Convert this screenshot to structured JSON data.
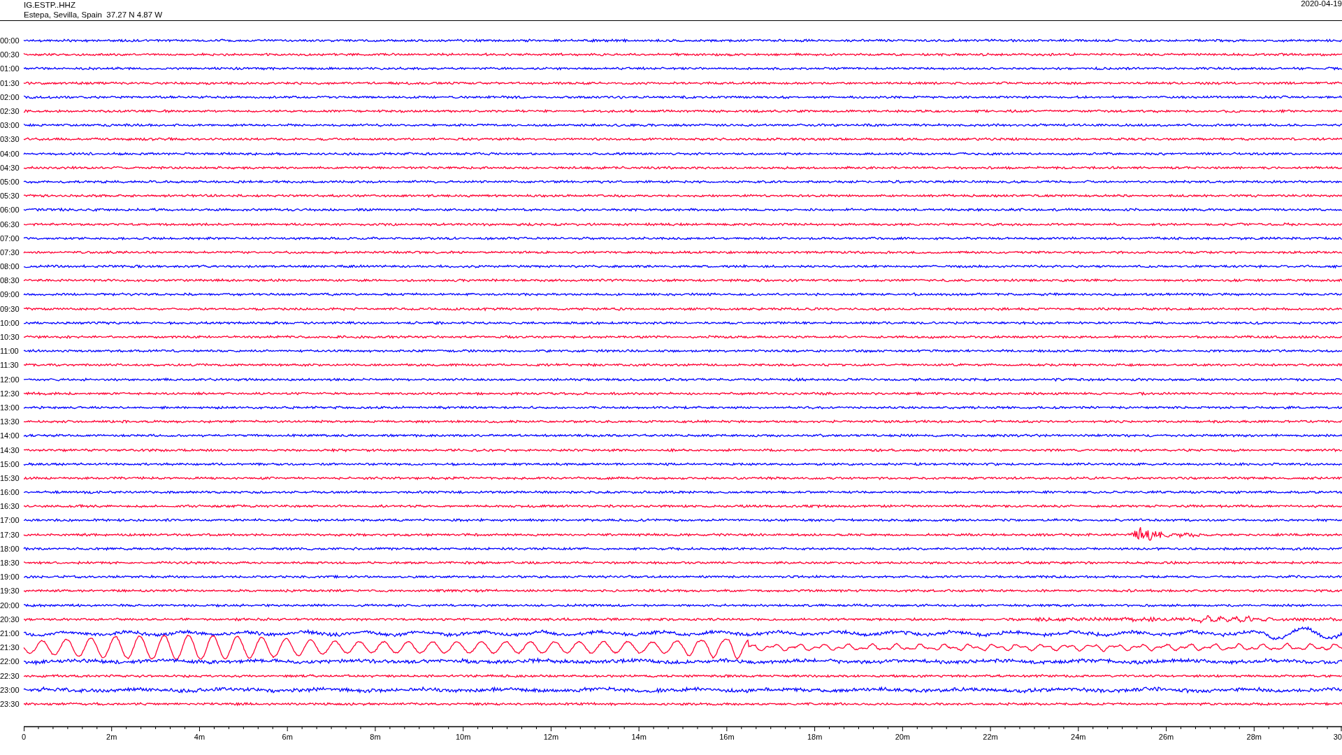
{
  "header": {
    "station": "IG.ESTP..HHZ",
    "location": "Estepa, Sevilla, Spain  37.27 N 4.87 W",
    "date": "2020-04-19"
  },
  "rows": [
    {
      "time": "00:00",
      "color": "#0000ff",
      "kind": "quiet"
    },
    {
      "time": "00:30",
      "color": "#ff0033",
      "kind": "quiet"
    },
    {
      "time": "01:00",
      "color": "#0000ff",
      "kind": "quiet"
    },
    {
      "time": "01:30",
      "color": "#ff0033",
      "kind": "quiet"
    },
    {
      "time": "02:00",
      "color": "#0000ff",
      "kind": "quiet"
    },
    {
      "time": "02:30",
      "color": "#ff0033",
      "kind": "quiet"
    },
    {
      "time": "03:00",
      "color": "#0000ff",
      "kind": "quiet"
    },
    {
      "time": "03:30",
      "color": "#ff0033",
      "kind": "quiet"
    },
    {
      "time": "04:00",
      "color": "#0000ff",
      "kind": "quiet"
    },
    {
      "time": "04:30",
      "color": "#ff0033",
      "kind": "quiet"
    },
    {
      "time": "05:00",
      "color": "#0000ff",
      "kind": "quiet"
    },
    {
      "time": "05:30",
      "color": "#ff0033",
      "kind": "quiet"
    },
    {
      "time": "06:00",
      "color": "#0000ff",
      "kind": "quiet"
    },
    {
      "time": "06:30",
      "color": "#ff0033",
      "kind": "quiet"
    },
    {
      "time": "07:00",
      "color": "#0000ff",
      "kind": "quiet"
    },
    {
      "time": "07:30",
      "color": "#ff0033",
      "kind": "quiet"
    },
    {
      "time": "08:00",
      "color": "#0000ff",
      "kind": "quiet"
    },
    {
      "time": "08:30",
      "color": "#ff0033",
      "kind": "quiet"
    },
    {
      "time": "09:00",
      "color": "#0000ff",
      "kind": "quiet"
    },
    {
      "time": "09:30",
      "color": "#ff0033",
      "kind": "quiet"
    },
    {
      "time": "10:00",
      "color": "#0000ff",
      "kind": "quiet"
    },
    {
      "time": "10:30",
      "color": "#ff0033",
      "kind": "quiet"
    },
    {
      "time": "11:00",
      "color": "#0000ff",
      "kind": "quiet"
    },
    {
      "time": "11:30",
      "color": "#ff0033",
      "kind": "quiet"
    },
    {
      "time": "12:00",
      "color": "#0000ff",
      "kind": "quiet"
    },
    {
      "time": "12:30",
      "color": "#ff0033",
      "kind": "quiet"
    },
    {
      "time": "13:00",
      "color": "#0000ff",
      "kind": "quiet"
    },
    {
      "time": "13:30",
      "color": "#ff0033",
      "kind": "quiet"
    },
    {
      "time": "14:00",
      "color": "#0000ff",
      "kind": "quiet"
    },
    {
      "time": "14:30",
      "color": "#ff0033",
      "kind": "quiet"
    },
    {
      "time": "15:00",
      "color": "#0000ff",
      "kind": "quiet"
    },
    {
      "time": "15:30",
      "color": "#ff0033",
      "kind": "quiet"
    },
    {
      "time": "16:00",
      "color": "#0000ff",
      "kind": "quiet"
    },
    {
      "time": "16:30",
      "color": "#ff0033",
      "kind": "quiet"
    },
    {
      "time": "17:00",
      "color": "#0000ff",
      "kind": "quiet"
    },
    {
      "time": "17:30",
      "color": "#ff0033",
      "kind": "event"
    },
    {
      "time": "18:00",
      "color": "#0000ff",
      "kind": "quiet"
    },
    {
      "time": "18:30",
      "color": "#ff0033",
      "kind": "quiet"
    },
    {
      "time": "19:00",
      "color": "#0000ff",
      "kind": "quiet"
    },
    {
      "time": "19:30",
      "color": "#ff0033",
      "kind": "quiet"
    },
    {
      "time": "20:00",
      "color": "#0000ff",
      "kind": "quiet"
    },
    {
      "time": "20:30",
      "color": "#ff0033",
      "kind": "onset"
    },
    {
      "time": "21:00",
      "color": "#0000ff",
      "kind": "ripple"
    },
    {
      "time": "21:30",
      "color": "#ff0033",
      "kind": "swell"
    },
    {
      "time": "22:00",
      "color": "#0000ff",
      "kind": "noisy"
    },
    {
      "time": "22:30",
      "color": "#ff0033",
      "kind": "quiet"
    },
    {
      "time": "23:00",
      "color": "#0000ff",
      "kind": "noisy"
    },
    {
      "time": "23:30",
      "color": "#ff0033",
      "kind": "quiet"
    }
  ],
  "axis": {
    "ticks": [
      "0",
      "2m",
      "4m",
      "6m",
      "8m",
      "10m",
      "12m",
      "14m",
      "16m",
      "18m",
      "20m",
      "22m",
      "24m",
      "26m",
      "28m",
      "30"
    ]
  }
}
